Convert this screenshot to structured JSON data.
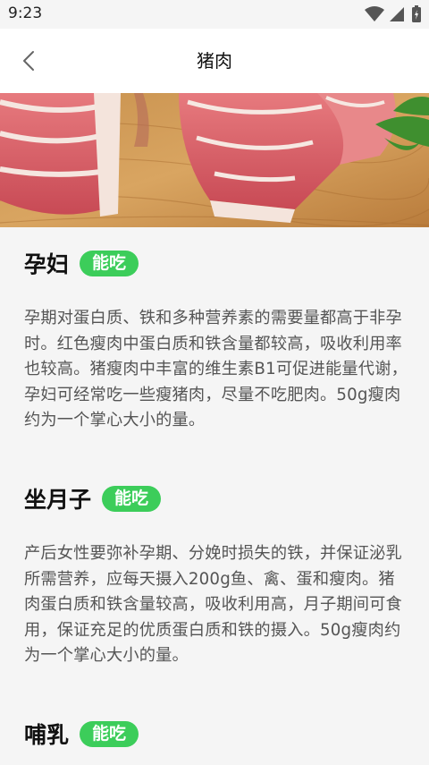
{
  "status_bar": {
    "time": "9:23",
    "icons": [
      "wifi-icon",
      "signal-icon",
      "battery-icon"
    ]
  },
  "header": {
    "title": "猪肉",
    "back_icon": "chevron-left-icon"
  },
  "hero": {
    "image": "raw pork slices on wooden board"
  },
  "sections": [
    {
      "title": "孕妇",
      "badge": "能吃",
      "text": "孕期对蛋白质、铁和多种营养素的需要量都高于非孕时。红色瘦肉中蛋白质和铁含量都较高，吸收利用率也较高。猪瘦肉中丰富的维生素B1可促进能量代谢，孕妇可经常吃一些瘦猪肉，尽量不吃肥肉。50g瘦肉约为一个掌心大小的量。"
    },
    {
      "title": "坐月子",
      "badge": "能吃",
      "text": "产后女性要弥补孕期、分娩时损失的铁，并保证泌乳所需营养，应每天摄入200g鱼、禽、蛋和瘦肉。猪肉蛋白质和铁含量较高，吸收利用高，月子期间可食用，保证充足的优质蛋白质和铁的摄入。50g瘦肉约为一个掌心大小的量。"
    },
    {
      "title": "哺乳",
      "badge": "能吃",
      "text": ""
    }
  ],
  "colors": {
    "badge": "#3ccd5a",
    "background": "#f5f5f5",
    "header": "#ffffff"
  }
}
